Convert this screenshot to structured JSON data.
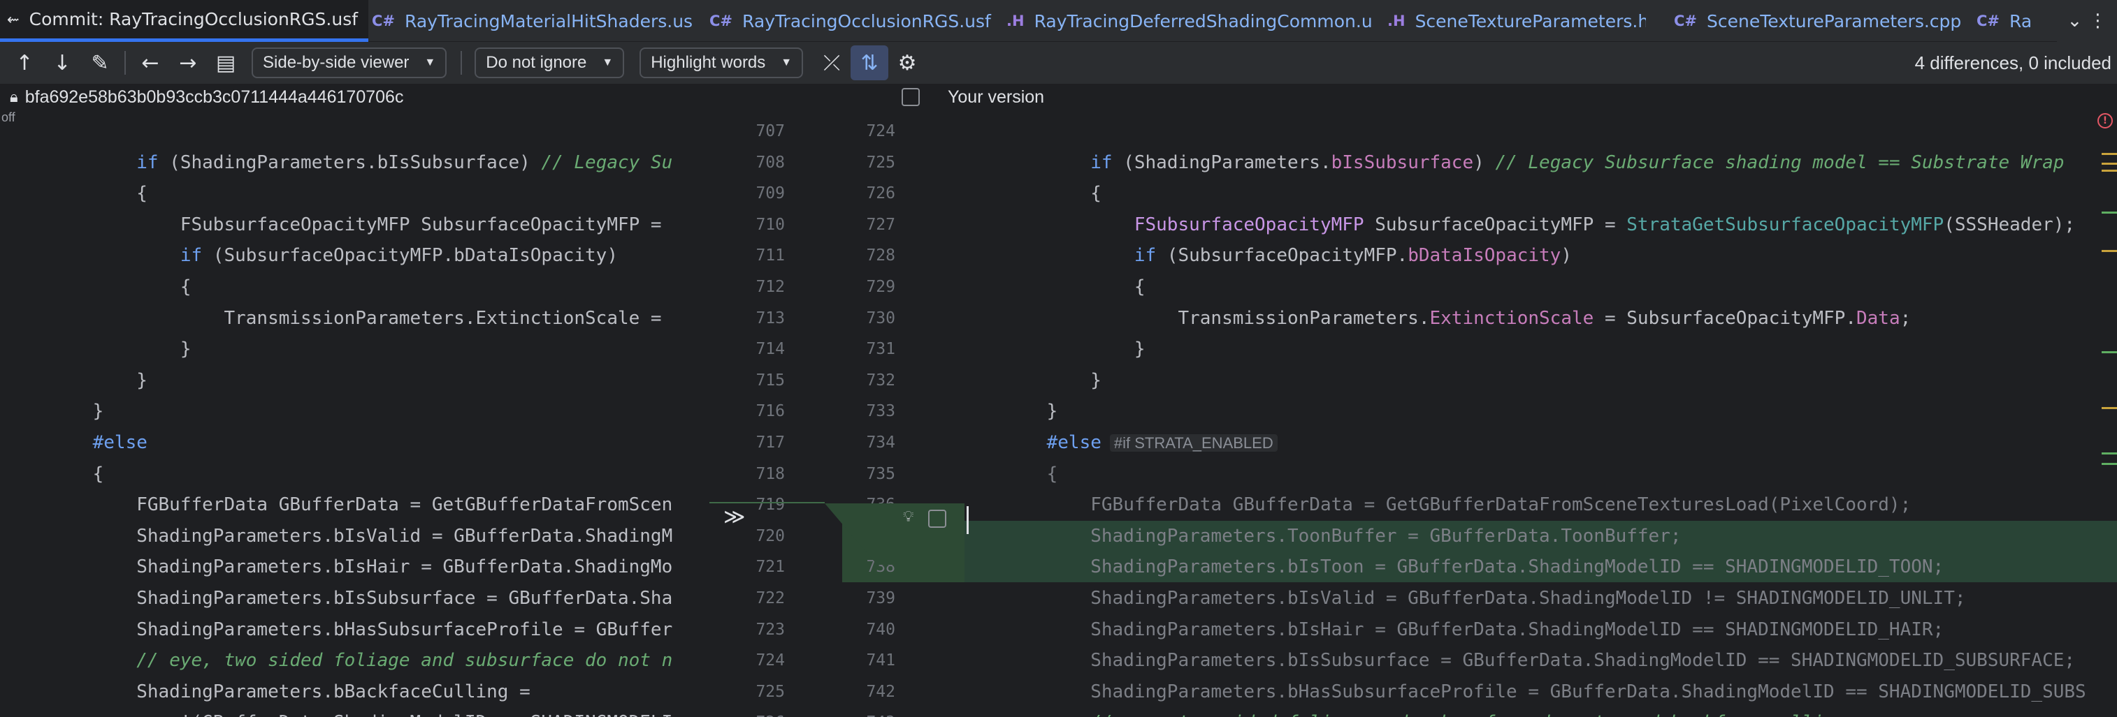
{
  "tabs": [
    {
      "label": "Commit: RayTracingOcclusionRGS.usf",
      "icon": "commit-icon",
      "lang": "",
      "active": true
    },
    {
      "label": "RayTracingMaterialHitShaders.usf",
      "icon": "cpp-file-icon",
      "lang": "C#",
      "active": false
    },
    {
      "label": "RayTracingOcclusionRGS.usf",
      "icon": "cpp-file-icon",
      "lang": "C#",
      "active": false
    },
    {
      "label": "RayTracingDeferredShadingCommon.ush",
      "icon": "header-file-icon",
      "lang": ".H",
      "active": false
    },
    {
      "label": "SceneTextureParameters.h",
      "icon": "header-file-icon",
      "lang": ".H",
      "active": false
    },
    {
      "label": "SceneTextureParameters.cpp",
      "icon": "cpp-file-icon",
      "lang": "C#",
      "active": false
    },
    {
      "label": "Ra",
      "icon": "cpp-file-icon",
      "lang": "C#",
      "active": false
    }
  ],
  "toolbar": {
    "viewer": "Side-by-side viewer",
    "ignore": "Do not ignore",
    "highlight": "Highlight words",
    "differences": "4 differences, 0 included"
  },
  "header": {
    "left_hash": "bfa692e58b63b0b93ccb3c0711444a446170706c",
    "right_label": "Your version",
    "left_off": "off"
  },
  "left_lines": [
    {
      "n": "707",
      "html": ""
    },
    {
      "n": "708",
      "html": "        <span class='kw'>if</span> (ShadingParameters.bIsSubsurface) <span class='cm'>// Legacy Su</span>"
    },
    {
      "n": "709",
      "html": "        {"
    },
    {
      "n": "710",
      "html": "            FSubsurfaceOpacityMFP SubsurfaceOpacityMFP ="
    },
    {
      "n": "711",
      "html": "            <span class='kw'>if</span> (SubsurfaceOpacityMFP.bDataIsOpacity)"
    },
    {
      "n": "712",
      "html": "            {"
    },
    {
      "n": "713",
      "html": "                TransmissionParameters.ExtinctionScale ="
    },
    {
      "n": "714",
      "html": "            }"
    },
    {
      "n": "715",
      "html": "        }"
    },
    {
      "n": "716",
      "html": "    }"
    },
    {
      "n": "717",
      "html": "    <span class='pp'>#else</span>"
    },
    {
      "n": "718",
      "html": "    {"
    },
    {
      "n": "719",
      "html": "        FGBufferData GBufferData = GetGBufferDataFromScen"
    },
    {
      "n": "720",
      "html": "        ShadingParameters.bIsValid = GBufferData.ShadingM"
    },
    {
      "n": "721",
      "html": "        ShadingParameters.bIsHair = GBufferData.ShadingMo"
    },
    {
      "n": "722",
      "html": "        ShadingParameters.bIsSubsurface = GBufferData.Sha"
    },
    {
      "n": "723",
      "html": "        ShadingParameters.bHasSubsurfaceProfile = GBuffer"
    },
    {
      "n": "724",
      "html": "        <span class='cm'>// eye, two sided foliage and subsurface do not n</span>"
    },
    {
      "n": "725",
      "html": "        ShadingParameters.bBackfaceCulling ="
    },
    {
      "n": "726",
      "html": "            !(GBufferData.ShadingModelID == SHADINGMODELI"
    }
  ],
  "right_lines": [
    {
      "n": "724",
      "html": ""
    },
    {
      "n": "725",
      "html": "        <span class='kw'>if</span> (ShadingParameters.<span class='mb'>bIsSubsurface</span>) <span class='cm'>// Legacy Subsurface shading model == Substrate Wrap</span>"
    },
    {
      "n": "726",
      "html": "        {"
    },
    {
      "n": "727",
      "html": "            <span class='ty'>FSubsurfaceOpacityMFP</span> SubsurfaceOpacityMFP = <span class='fn'>StrataGetSubsurfaceOpacityMFP</span>(SSSHeader);"
    },
    {
      "n": "728",
      "html": "            <span class='kw'>if</span> (SubsurfaceOpacityMFP.<span class='mb'>bDataIsOpacity</span>)"
    },
    {
      "n": "729",
      "html": "            {"
    },
    {
      "n": "730",
      "html": "                TransmissionParameters.<span class='mb'>ExtinctionScale</span> = SubsurfaceOpacityMFP.<span class='mb'>Data</span>;"
    },
    {
      "n": "731",
      "html": "            }"
    },
    {
      "n": "732",
      "html": "        }"
    },
    {
      "n": "733",
      "html": "    }"
    },
    {
      "n": "734",
      "html": "    <span class='pp'>#else</span><span class='inlay'>#if STRATA_ENABLED</span>"
    },
    {
      "n": "735",
      "html": "    <span class='dim'>{</span>"
    },
    {
      "n": "736",
      "html": "        <span class='dim'>FGBufferData GBufferData = GetGBufferDataFromSceneTexturesLoad(PixelCoord);</span>"
    },
    {
      "n": "737",
      "html": "        <span class='dim'>ShadingParameters.ToonBuffer = GBufferData.ToonBuffer;</span>"
    },
    {
      "n": "738",
      "html": "        <span class='dim'>ShadingParameters.bIsToon = GBufferData.ShadingModelID == SHADINGMODELID_TOON;</span>"
    },
    {
      "n": "739",
      "html": "        <span class='dim'>ShadingParameters.bIsValid = GBufferData.ShadingModelID != SHADINGMODELID_UNLIT;</span>"
    },
    {
      "n": "740",
      "html": "        <span class='dim'>ShadingParameters.bIsHair = GBufferData.ShadingModelID == SHADINGMODELID_HAIR;</span>"
    },
    {
      "n": "741",
      "html": "        <span class='dim'>ShadingParameters.bIsSubsurface = GBufferData.ShadingModelID == SHADINGMODELID_SUBSURFACE;</span>"
    },
    {
      "n": "742",
      "html": "        <span class='dim'>ShadingParameters.bHasSubsurfaceProfile = GBufferData.ShadingModelID == SHADINGMODELID_SUBS</span>"
    },
    {
      "n": "743",
      "html": "        <span class='cm'>// eye, two sided foliage and subsurface do not need backface culling.</span>"
    }
  ],
  "changed_right_lines": [
    13,
    14
  ],
  "colors": {
    "accent": "#3574f0",
    "added_bg": "#294436",
    "error": "#e55765"
  }
}
